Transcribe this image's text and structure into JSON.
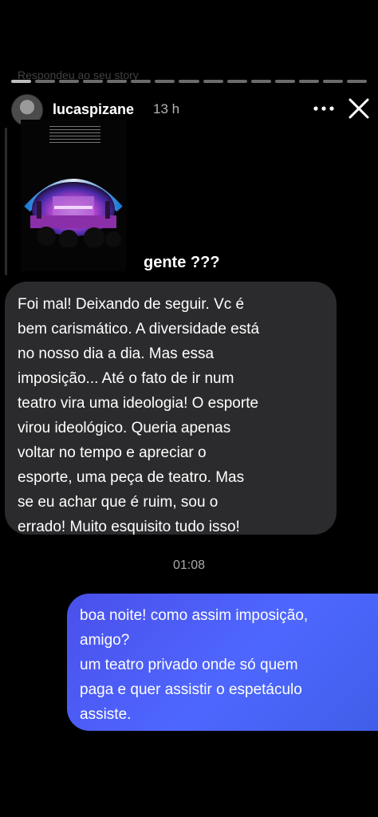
{
  "story": {
    "replied_line": "Respondeu ao seu story",
    "username": "lucaspizane",
    "time": "13 h",
    "reply_label": "gente ???"
  },
  "messages": {
    "incoming_lines": [
      "Foi mal! Deixando de seguir. Vc é",
      "bem carismático. A diversidade está",
      "no nosso dia a dia. Mas essa",
      "imposição... Até o fato de ir num",
      "teatro vira uma ideologia! O esporte",
      "virou ideológico. Queria apenas",
      "voltar no tempo e apreciar o",
      "esporte, uma peça de teatro. Mas",
      "se eu achar que é ruim, sou o",
      "errado! Muito esquisito tudo isso!"
    ],
    "timestamp": "01:08",
    "outgoing_lines": [
      "boa noite! como assim imposição,",
      "amigo?",
      "um teatro privado onde só quem",
      "paga e quer assistir o espetáculo",
      "assiste."
    ]
  },
  "icons": {
    "more": "more-horizontal-icon",
    "close": "close-icon"
  },
  "colors": {
    "background": "#000000",
    "incoming_bubble": "#2b2b2d",
    "outgoing_bubble": "#4e67ff"
  }
}
